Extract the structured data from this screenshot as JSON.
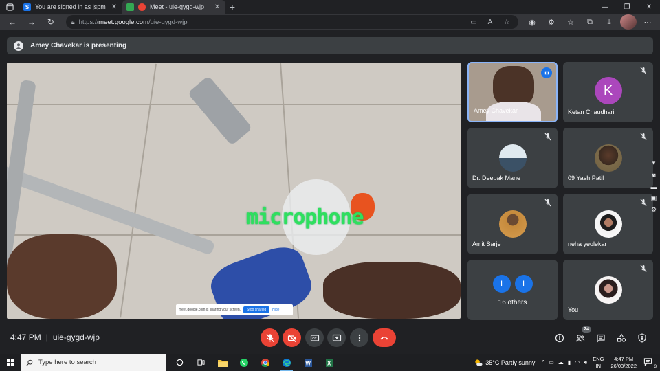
{
  "browser": {
    "tabs": [
      {
        "title": "You are signed in as jspm",
        "favicon_letter": "S",
        "favicon_color": "#1a73e8",
        "active": false
      },
      {
        "title": "Meet - uie-gygd-wjp",
        "favicon_letter": "",
        "favicon_color": "#ea4335",
        "active": true
      }
    ],
    "url_scheme": "https://",
    "url_host": "meet.google.com",
    "url_path": "/uie-gygd-wjp"
  },
  "meet": {
    "presenting_banner": "Amey Chavekar is presenting",
    "shared_screen_overlay_text": "microphone",
    "share_notice": {
      "message": "meet.google.com is sharing your screen.",
      "stop_label": "Stop sharing",
      "hide_label": "Hide"
    },
    "participants": [
      {
        "name": "Amey Chavekar",
        "speaking": true,
        "muted": false
      },
      {
        "name": "Ketan Chaudhari",
        "initial": "K",
        "avatar_color": "#ab47bc",
        "muted": true
      },
      {
        "name": "Dr. Deepak Mane",
        "muted": true
      },
      {
        "name": "09 Yash Patil",
        "muted": true
      },
      {
        "name": "Amit Sarje",
        "muted": true
      },
      {
        "name": "neha yeolekar",
        "muted": true
      },
      {
        "name": "16 others",
        "initials": [
          "I",
          "I"
        ]
      },
      {
        "name": "You",
        "muted": true
      }
    ],
    "time": "4:47 PM",
    "meeting_code": "uie-gygd-wjp",
    "people_count": "24",
    "colors": {
      "danger": "#ea4335",
      "accent": "#1a73e8",
      "surface": "#3c4043",
      "background": "#202124"
    }
  },
  "taskbar": {
    "search_placeholder": "Type here to search",
    "weather": "35°C  Partly sunny",
    "lang_line1": "ENG",
    "lang_line2": "IN",
    "clock_time": "4:47 PM",
    "clock_date": "26/03/2022",
    "notification_count": "3"
  }
}
